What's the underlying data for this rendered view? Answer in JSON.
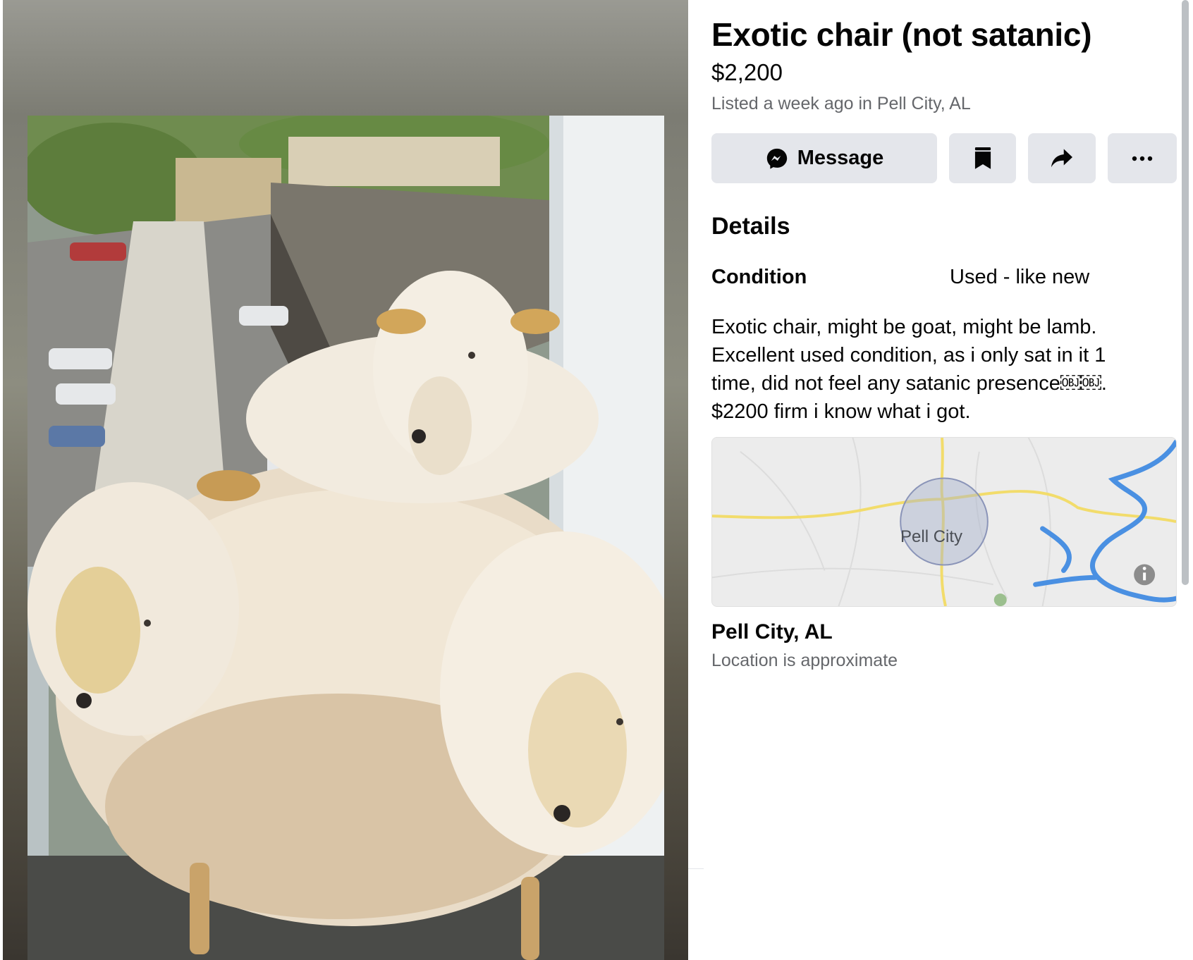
{
  "listing": {
    "title": "Exotic chair (not satanic)",
    "price": "$2,200",
    "listed": "Listed a week ago in Pell City, AL"
  },
  "actions": {
    "message_label": "Message",
    "message_icon": "messenger-icon",
    "save_icon": "bookmark-icon",
    "share_icon": "share-arrow-icon",
    "more_icon": "more-dots-icon"
  },
  "details": {
    "section_title": "Details",
    "condition_label": "Condition",
    "condition_value": "Used - like new",
    "description_lines": [
      "Exotic chair, might be goat, might be lamb.",
      "Excellent used condition, as i only sat in it 1",
      "time, did not feel any satanic presence￼￼.",
      "$2200 firm i know what i got."
    ]
  },
  "map": {
    "city_label": "Pell City",
    "info_icon": "info-icon",
    "road_color": "#f2dc6b",
    "water_color": "#4a90e2"
  },
  "location": {
    "name": "Pell City, AL",
    "note": "Location is approximate"
  }
}
